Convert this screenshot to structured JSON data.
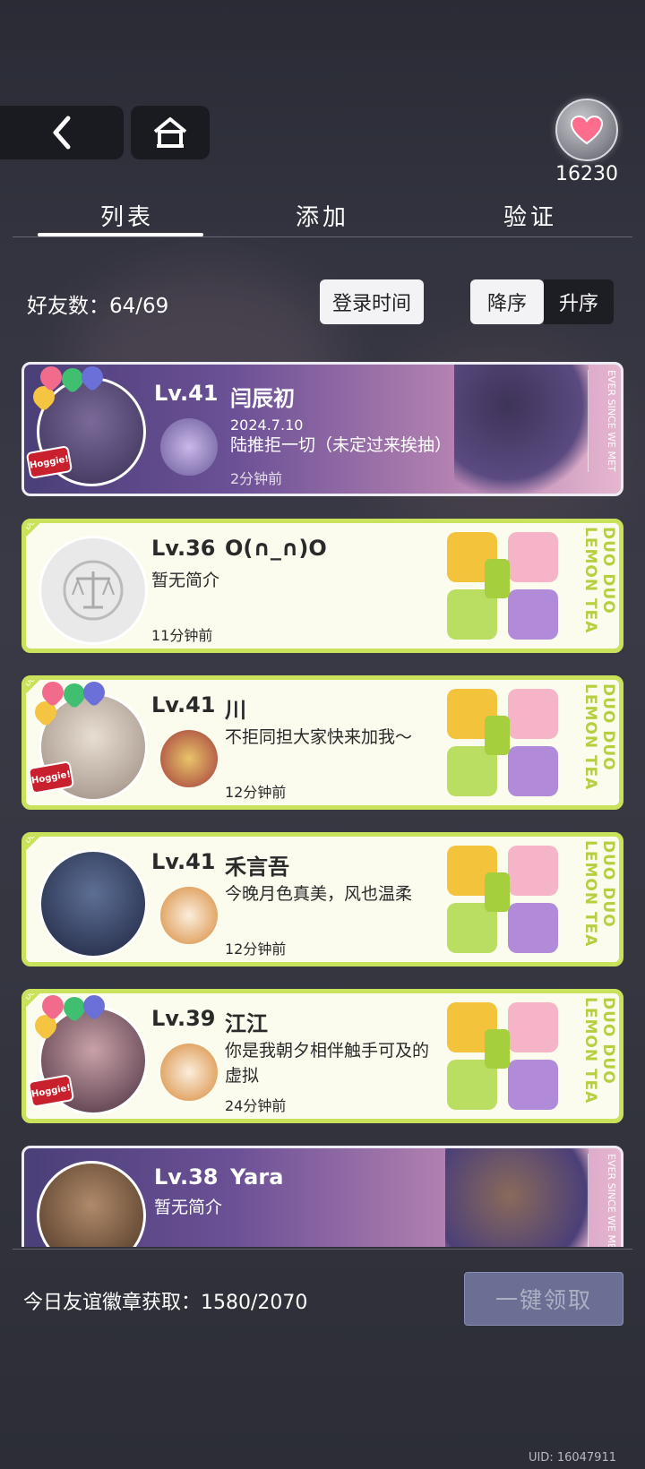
{
  "header": {
    "currency_value": "16230"
  },
  "tabs": [
    {
      "label": "列表",
      "active": true
    },
    {
      "label": "添加",
      "active": false
    },
    {
      "label": "验证",
      "active": false
    }
  ],
  "friends_summary": {
    "label": "好友数：",
    "value": "64/69"
  },
  "sort": {
    "field_label": "登录时间",
    "descending_label": "降序",
    "ascending_label": "升序",
    "selected": "降序"
  },
  "friends": [
    {
      "level": "Lv.41",
      "name": "闫辰初",
      "date": "2024.7.10",
      "bio": "陆推拒一切（未定过来挨抽）",
      "time": "2分钟前",
      "card_style": "ever-since-we-met"
    },
    {
      "level": "Lv.36",
      "name": "O(∩_∩)O",
      "bio": "暂无简介",
      "time": "11分钟前",
      "card_style": "duo-duo-lemon-tea"
    },
    {
      "level": "Lv.41",
      "name": "川",
      "bio": "不拒同担大家快来加我～",
      "time": "12分钟前",
      "card_style": "duo-duo-lemon-tea"
    },
    {
      "level": "Lv.41",
      "name": "禾言吾",
      "bio": "今晚月色真美，风也温柔",
      "time": "12分钟前",
      "card_style": "duo-duo-lemon-tea"
    },
    {
      "level": "Lv.39",
      "name": "江江",
      "bio": "你是我朝夕相伴触手可及的虚拟",
      "time": "24分钟前",
      "card_style": "duo-duo-lemon-tea"
    },
    {
      "level": "Lv.38",
      "name": "Yara",
      "bio": "暂无简介",
      "card_style": "ever-since-we-met"
    }
  ],
  "card_labels": {
    "duo_duo": "DUO DUO",
    "lemon_tea": "LEMON TEA",
    "ever_since": "EVER SINCE WE MET",
    "hoggie": "Hoggie!"
  },
  "bottom": {
    "badge_label": "今日友谊徽章获取：",
    "badge_value": "1580/2070",
    "claim_label": "一键领取",
    "uid": "UID: 16047911"
  },
  "colors": {
    "lemon_border": "#c8e35b",
    "ever_gradient_start": "#4b3f78",
    "ever_gradient_end": "#e6b6cf",
    "claim_button": "#6b6f93"
  }
}
